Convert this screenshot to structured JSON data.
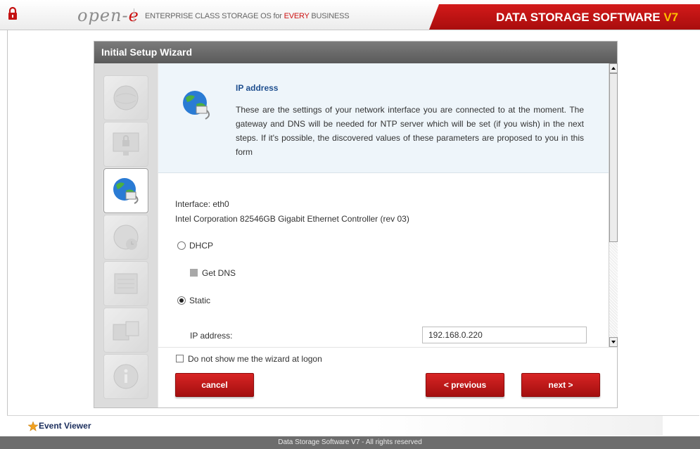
{
  "header": {
    "logo_text": "open-e",
    "tagline_prefix": "ENTERPRISE CLASS STORAGE OS for ",
    "tagline_highlight": "EVERY",
    "tagline_suffix": " BUSINESS",
    "product_name": "DATA STORAGE SOFTWARE ",
    "product_version": "V7"
  },
  "wizard": {
    "title": "Initial Setup Wizard",
    "steps": [
      {
        "icon": "globe-icon",
        "active": false
      },
      {
        "icon": "lock-monitor-icon",
        "active": false
      },
      {
        "icon": "network-globe-icon",
        "active": true
      },
      {
        "icon": "clock-icon",
        "active": false
      },
      {
        "icon": "server-icon",
        "active": false
      },
      {
        "icon": "storage-icon",
        "active": false
      },
      {
        "icon": "info-icon",
        "active": false
      }
    ],
    "section_title": "IP address",
    "section_description": "These are the settings of your network interface you are connected to at the moment. The gateway and DNS will be needed for NTP server which will be set (if you wish) in the next steps. If it's possible, the discovered values of these parameters are proposed to you in this form",
    "interface_label": "Interface: eth0",
    "controller": "Intel Corporation 82546GB Gigabit Ethernet Controller (rev 03)",
    "dhcp_label": "DHCP",
    "get_dns_label": "Get DNS",
    "static_label": "Static",
    "ip_label": "IP address:",
    "ip_value": "192.168.0.220",
    "mode_selected": "Static",
    "dont_show_label": "Do not show me the wizard at logon",
    "cancel_label": "cancel",
    "previous_label": "< previous",
    "next_label": "next >"
  },
  "event_viewer": {
    "label": "Event Viewer"
  },
  "footer": {
    "text": "Data Storage Software V7 - All rights reserved"
  },
  "colors": {
    "brand_red": "#c41212",
    "version_yellow": "#ffc000",
    "title_blue": "#1f4f8f"
  }
}
